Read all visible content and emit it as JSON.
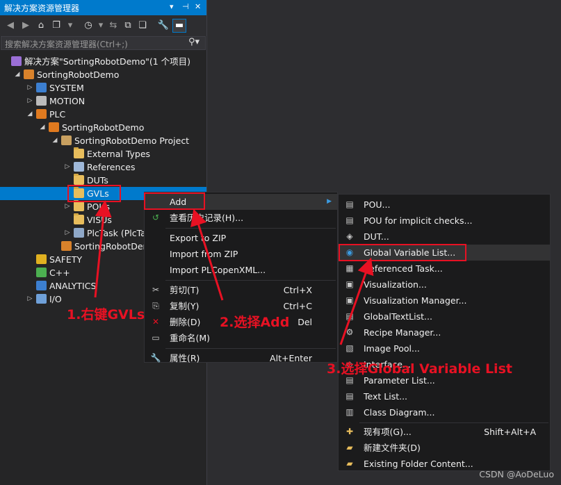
{
  "panel": {
    "title": "解决方案资源管理器",
    "title_controls": [
      "▾",
      "⊣",
      "✕"
    ],
    "search_placeholder": "搜索解决方案资源管理器(Ctrl+;)"
  },
  "tree": [
    {
      "label": "解决方案\"SortingRobotDemo\"(1 个项目)",
      "icon": "solution-icon",
      "indent": 0,
      "arrow": ""
    },
    {
      "label": "SortingRobotDemo",
      "icon": "project-icon",
      "indent": 1,
      "arrow": "◢"
    },
    {
      "label": "SYSTEM",
      "icon": "system-icon",
      "indent": 2,
      "arrow": "▷"
    },
    {
      "label": "MOTION",
      "icon": "motion-icon",
      "indent": 2,
      "arrow": "▷"
    },
    {
      "label": "PLC",
      "icon": "plc-icon",
      "indent": 2,
      "arrow": "◢"
    },
    {
      "label": "SortingRobotDemo",
      "icon": "plc-project-icon",
      "indent": 3,
      "arrow": "◢"
    },
    {
      "label": "SortingRobotDemo Project",
      "icon": "plc-subproject-icon",
      "indent": 4,
      "arrow": "◢"
    },
    {
      "label": "External Types",
      "icon": "folder-icon",
      "indent": 5,
      "arrow": ""
    },
    {
      "label": "References",
      "icon": "references-icon",
      "indent": 5,
      "arrow": "▷"
    },
    {
      "label": "DUTs",
      "icon": "folder-icon",
      "indent": 5,
      "arrow": ""
    },
    {
      "label": "GVLs",
      "icon": "folder-icon",
      "indent": 5,
      "arrow": "",
      "selected": true
    },
    {
      "label": "POUs",
      "icon": "folder-icon",
      "indent": 5,
      "arrow": "▷"
    },
    {
      "label": "VISUs",
      "icon": "folder-icon",
      "indent": 5,
      "arrow": ""
    },
    {
      "label": "PlcTask (PlcTa",
      "icon": "task-icon",
      "indent": 5,
      "arrow": "▷"
    },
    {
      "label": "SortingRobotDem",
      "icon": "instance-icon",
      "indent": 4,
      "arrow": ""
    },
    {
      "label": "SAFETY",
      "icon": "safety-icon",
      "indent": 2,
      "arrow": ""
    },
    {
      "label": "C++",
      "icon": "cpp-icon",
      "indent": 2,
      "arrow": ""
    },
    {
      "label": "ANALYTICS",
      "icon": "analytics-icon",
      "indent": 2,
      "arrow": ""
    },
    {
      "label": "I/O",
      "icon": "io-icon",
      "indent": 2,
      "arrow": "▷"
    }
  ],
  "context_menu": [
    {
      "label": "Add",
      "shortcut": "",
      "icon": "",
      "submenu": true,
      "highlighted": true
    },
    {
      "label": "查看历史记录(H)...",
      "shortcut": "",
      "icon": "history-icon"
    },
    {
      "separator": true
    },
    {
      "label": "Export to ZIP",
      "shortcut": "",
      "icon": ""
    },
    {
      "label": "Import from ZIP",
      "shortcut": "",
      "icon": ""
    },
    {
      "label": "Import PLCopenXML...",
      "shortcut": "",
      "icon": ""
    },
    {
      "separator": true
    },
    {
      "label": "剪切(T)",
      "shortcut": "Ctrl+X",
      "icon": "cut-icon"
    },
    {
      "label": "复制(Y)",
      "shortcut": "Ctrl+C",
      "icon": "copy-icon"
    },
    {
      "label": "删除(D)",
      "shortcut": "Del",
      "icon": "delete-icon"
    },
    {
      "label": "重命名(M)",
      "shortcut": "",
      "icon": "rename-icon"
    },
    {
      "separator": true
    },
    {
      "label": "属性(R)",
      "shortcut": "Alt+Enter",
      "icon": "properties-icon"
    }
  ],
  "add_submenu": [
    {
      "label": "POU...",
      "shortcut": "",
      "icon": "pou-icon"
    },
    {
      "label": "POU for implicit checks...",
      "shortcut": "",
      "icon": "pou-checks-icon"
    },
    {
      "label": "DUT...",
      "shortcut": "",
      "icon": "dut-icon"
    },
    {
      "label": "Global Variable List...",
      "shortcut": "",
      "icon": "gvl-icon",
      "highlighted": true
    },
    {
      "label": "Referenced Task...",
      "shortcut": "",
      "icon": "task-ref-icon"
    },
    {
      "label": "Visualization...",
      "shortcut": "",
      "icon": "visualization-icon"
    },
    {
      "label": "Visualization Manager...",
      "shortcut": "",
      "icon": "vis-manager-icon"
    },
    {
      "label": "GlobalTextList...",
      "shortcut": "",
      "icon": "textlist-icon"
    },
    {
      "label": "Recipe Manager...",
      "shortcut": "",
      "icon": "recipe-icon"
    },
    {
      "label": "Image Pool...",
      "shortcut": "",
      "icon": "image-pool-icon"
    },
    {
      "label": "Interface...",
      "shortcut": "",
      "icon": "interface-icon"
    },
    {
      "label": "Parameter List...",
      "shortcut": "",
      "icon": "parameter-icon"
    },
    {
      "label": "Text List...",
      "shortcut": "",
      "icon": "textlist2-icon"
    },
    {
      "label": "Class Diagram...",
      "shortcut": "",
      "icon": "class-diagram-icon"
    },
    {
      "separator": true
    },
    {
      "label": "现有项(G)...",
      "shortcut": "Shift+Alt+A",
      "icon": "existing-item-icon"
    },
    {
      "label": "新建文件夹(D)",
      "shortcut": "",
      "icon": "new-folder-icon"
    },
    {
      "label": "Existing Folder Content...",
      "shortcut": "",
      "icon": "folder-content-icon"
    }
  ],
  "annotations": {
    "step1": "1.右键GVLs",
    "step2": "2.选择Add",
    "step3": "3.选择Global Variable List"
  },
  "watermark": "CSDN @AoDeLuo",
  "colors": {
    "accent": "#007acc",
    "annotation": "#e81123",
    "folder": "#e8bd5c"
  }
}
